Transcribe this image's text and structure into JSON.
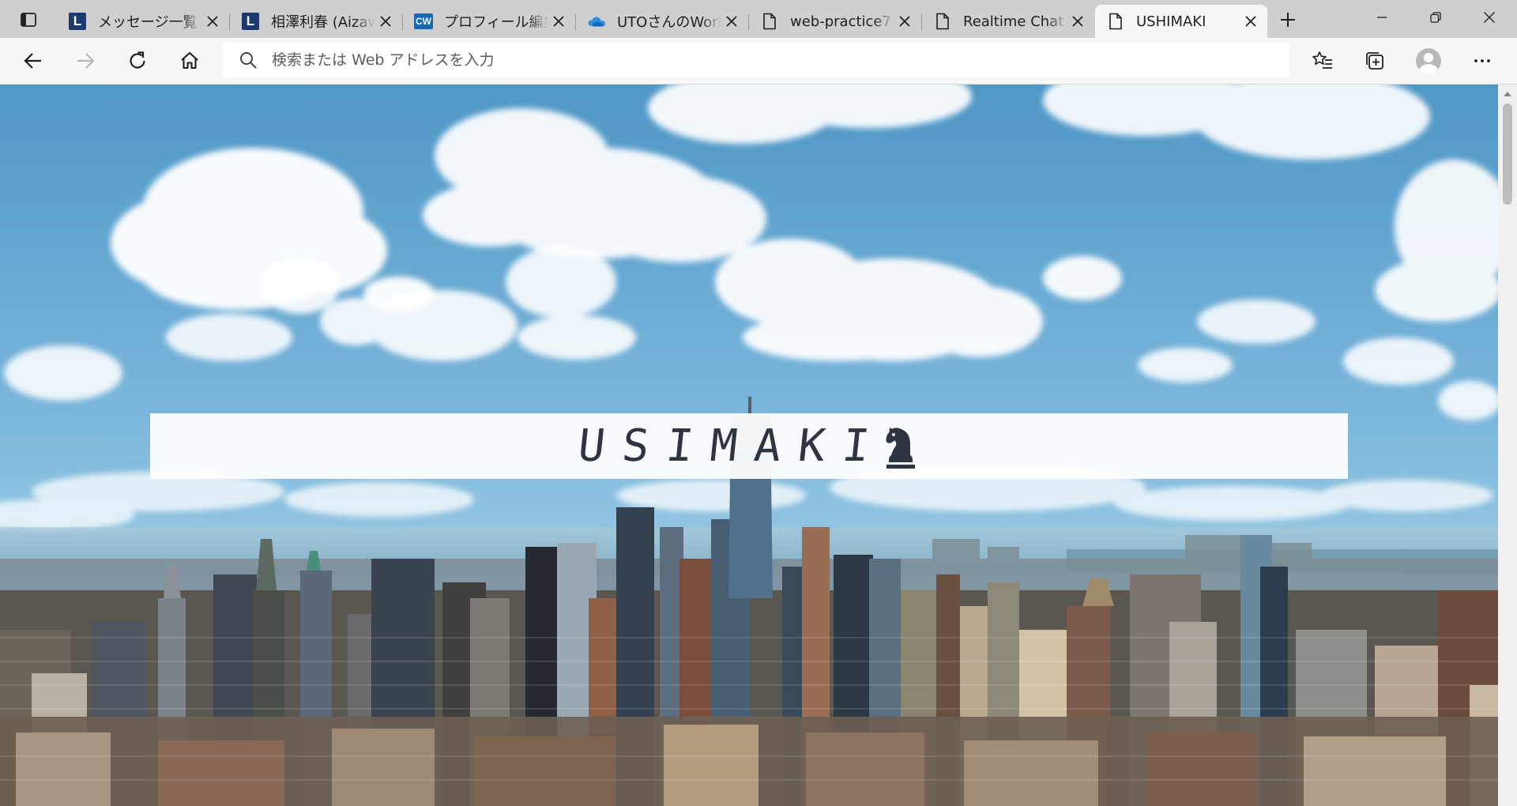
{
  "browser": {
    "tabs": [
      {
        "title": "メッセージ一覧 | ",
        "favicon": "lancers-icon",
        "active": false
      },
      {
        "title": "相澤利春 (Aizaw",
        "favicon": "lancers-icon",
        "active": false
      },
      {
        "title": "プロフィール編集 | ",
        "favicon": "crowdworks-icon",
        "active": false
      },
      {
        "title": "UTOさんのWork",
        "favicon": "onedrive-icon",
        "active": false
      },
      {
        "title": "web-practice7",
        "favicon": "page-icon",
        "active": false
      },
      {
        "title": "Realtime Chat",
        "favicon": "page-icon",
        "active": false
      },
      {
        "title": "USHIMAKI",
        "favicon": "page-icon",
        "active": true
      }
    ],
    "favicon_letters": {
      "lancers": "L",
      "crowdworks": "CW"
    },
    "address_bar": {
      "placeholder": "検索または Web アドレスを入力",
      "value": ""
    }
  },
  "page": {
    "logo_text": "USIMAKI",
    "logo_icon": "chess-knight-icon",
    "hero_description": "city-skyline-background",
    "scroll_position_fraction": 0.0
  },
  "colors": {
    "tab_strip": "#cfcfcf",
    "toolbar": "#f7f7f7",
    "logo_text": "#2d3540",
    "sky_top": "#4f97c6",
    "sky_bottom": "#9ccbe5"
  }
}
